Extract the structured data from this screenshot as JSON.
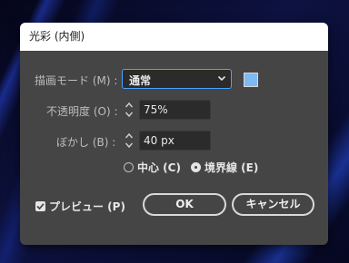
{
  "dialog": {
    "title": "光彩 (内側)",
    "blend_mode": {
      "label": "描画モード (M) :",
      "value": "通常"
    },
    "color_swatch": "#80b8f4",
    "opacity": {
      "label": "不透明度 (O) :",
      "value": "75%"
    },
    "blur": {
      "label": "ぼかし (B) :",
      "value": "40 px"
    },
    "source": {
      "options": [
        {
          "label": "中心 (C)",
          "selected": false
        },
        {
          "label": "境界線 (E)",
          "selected": true
        }
      ]
    },
    "preview": {
      "label": "プレビュー (P)",
      "checked": true
    },
    "ok_label": "OK",
    "cancel_label": "キャンセル"
  },
  "colors": {
    "dialog_bg": "#454545",
    "field_bg": "#2b2b2b",
    "focus_border": "#4aa3ff"
  }
}
